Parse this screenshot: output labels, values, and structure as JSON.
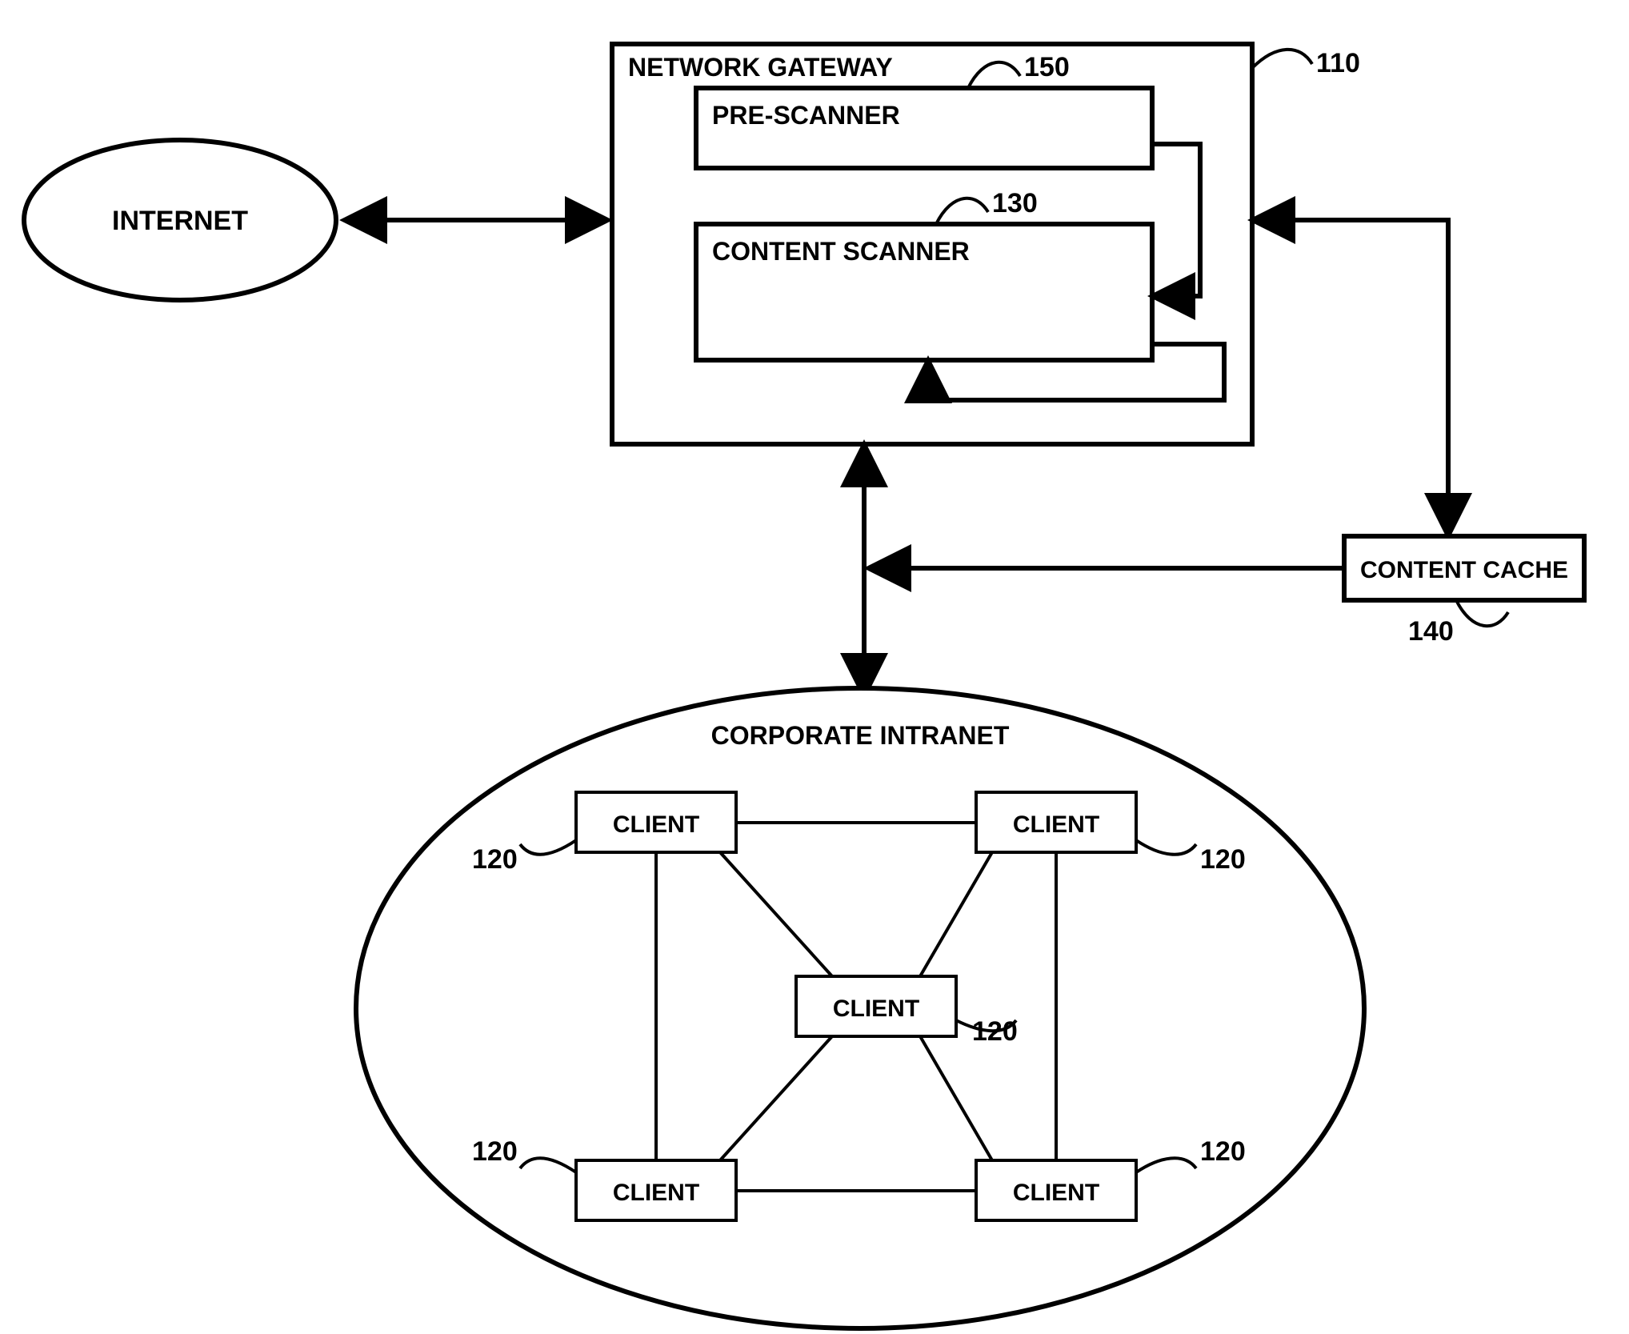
{
  "labels": {
    "internet": "INTERNET",
    "gateway_title": "NETWORK GATEWAY",
    "pre_scanner": "PRE-SCANNER",
    "content_scanner": "CONTENT SCANNER",
    "content_cache": "CONTENT CACHE",
    "intranet_title": "CORPORATE INTRANET",
    "client": "CLIENT",
    "ref_110": "110",
    "ref_120": "120",
    "ref_130": "130",
    "ref_140": "140",
    "ref_150": "150"
  }
}
